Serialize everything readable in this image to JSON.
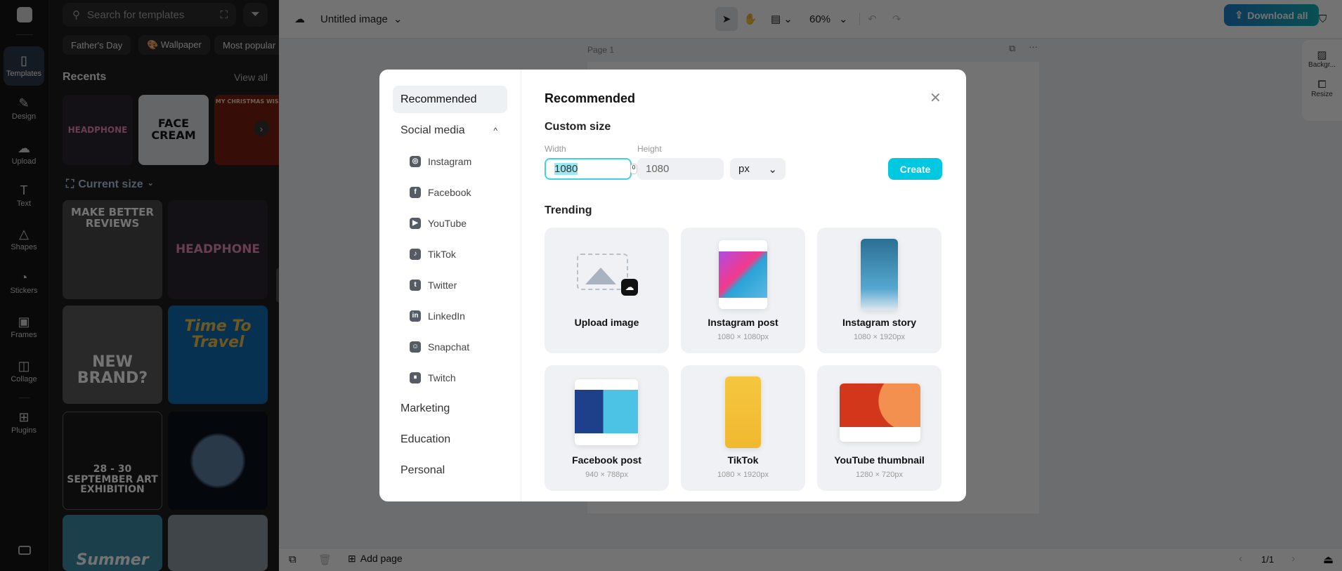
{
  "rail": {
    "items": [
      {
        "label": "Templates",
        "icon": "templates-icon",
        "glyph": "▯"
      },
      {
        "label": "Design",
        "icon": "design-icon",
        "glyph": "✎"
      },
      {
        "label": "Upload",
        "icon": "upload-cloud-icon",
        "glyph": "☁"
      },
      {
        "label": "Text",
        "icon": "text-icon",
        "glyph": "T"
      },
      {
        "label": "Shapes",
        "icon": "shapes-icon",
        "glyph": "△"
      },
      {
        "label": "Stickers",
        "icon": "stickers-icon",
        "glyph": "◔"
      },
      {
        "label": "Frames",
        "icon": "frames-icon",
        "glyph": "▣"
      },
      {
        "label": "Collage",
        "icon": "collage-icon",
        "glyph": "◫"
      },
      {
        "label": "Plugins",
        "icon": "plugins-icon",
        "glyph": "⊞"
      }
    ]
  },
  "panel": {
    "search_placeholder": "Search for templates",
    "chips": [
      "Father's Day",
      "🎨 Wallpaper",
      "Most popular"
    ],
    "recents_title": "Recents",
    "view_all": "View all",
    "recents": [
      "HEADPHONE",
      "FACE CREAM",
      "MY CHRISTMAS WISH"
    ],
    "current_size": "Current size",
    "templates": [
      "MAKE BETTER REVIEWS",
      "HEADPHONE",
      "NEW BRAND?",
      "Time To Travel",
      "28 - 30 SEPTEMBER ART EXHIBITION",
      "",
      "Summer",
      ""
    ]
  },
  "topbar": {
    "title": "Untitled image",
    "zoom": "60%",
    "download": "Download all"
  },
  "canvas": {
    "page_label": "Page 1",
    "right_tools": [
      "Backgr...",
      "Resize"
    ]
  },
  "bottombar": {
    "add_page": "Add page",
    "page_count": "1/1"
  },
  "modal": {
    "nav": {
      "recommended": "Recommended",
      "social": "Social media",
      "social_items": [
        {
          "label": "Instagram",
          "g": "◎"
        },
        {
          "label": "Facebook",
          "g": "f"
        },
        {
          "label": "YouTube",
          "g": "▶"
        },
        {
          "label": "TikTok",
          "g": "♪"
        },
        {
          "label": "Twitter",
          "g": "t"
        },
        {
          "label": "LinkedIn",
          "g": "in"
        },
        {
          "label": "Snapchat",
          "g": "☺"
        },
        {
          "label": "Twitch",
          "g": "⏸"
        }
      ],
      "others": [
        "Marketing",
        "Education",
        "Personal"
      ]
    },
    "title": "Recommended",
    "custom_size": "Custom size",
    "width_label": "Width",
    "height_label": "Height",
    "width_value": "1080",
    "height_value": "1080",
    "unit": "px",
    "create": "Create",
    "trending": "Trending",
    "cards": [
      {
        "title": "Upload image",
        "size": ""
      },
      {
        "title": "Instagram post",
        "size": "1080 × 1080px"
      },
      {
        "title": "Instagram story",
        "size": "1080 × 1920px"
      },
      {
        "title": "Facebook post",
        "size": "940 × 788px"
      },
      {
        "title": "TikTok",
        "size": "1080 × 1920px"
      },
      {
        "title": "YouTube thumbnail",
        "size": "1280 × 720px"
      }
    ],
    "accent": "#00c8e0"
  }
}
